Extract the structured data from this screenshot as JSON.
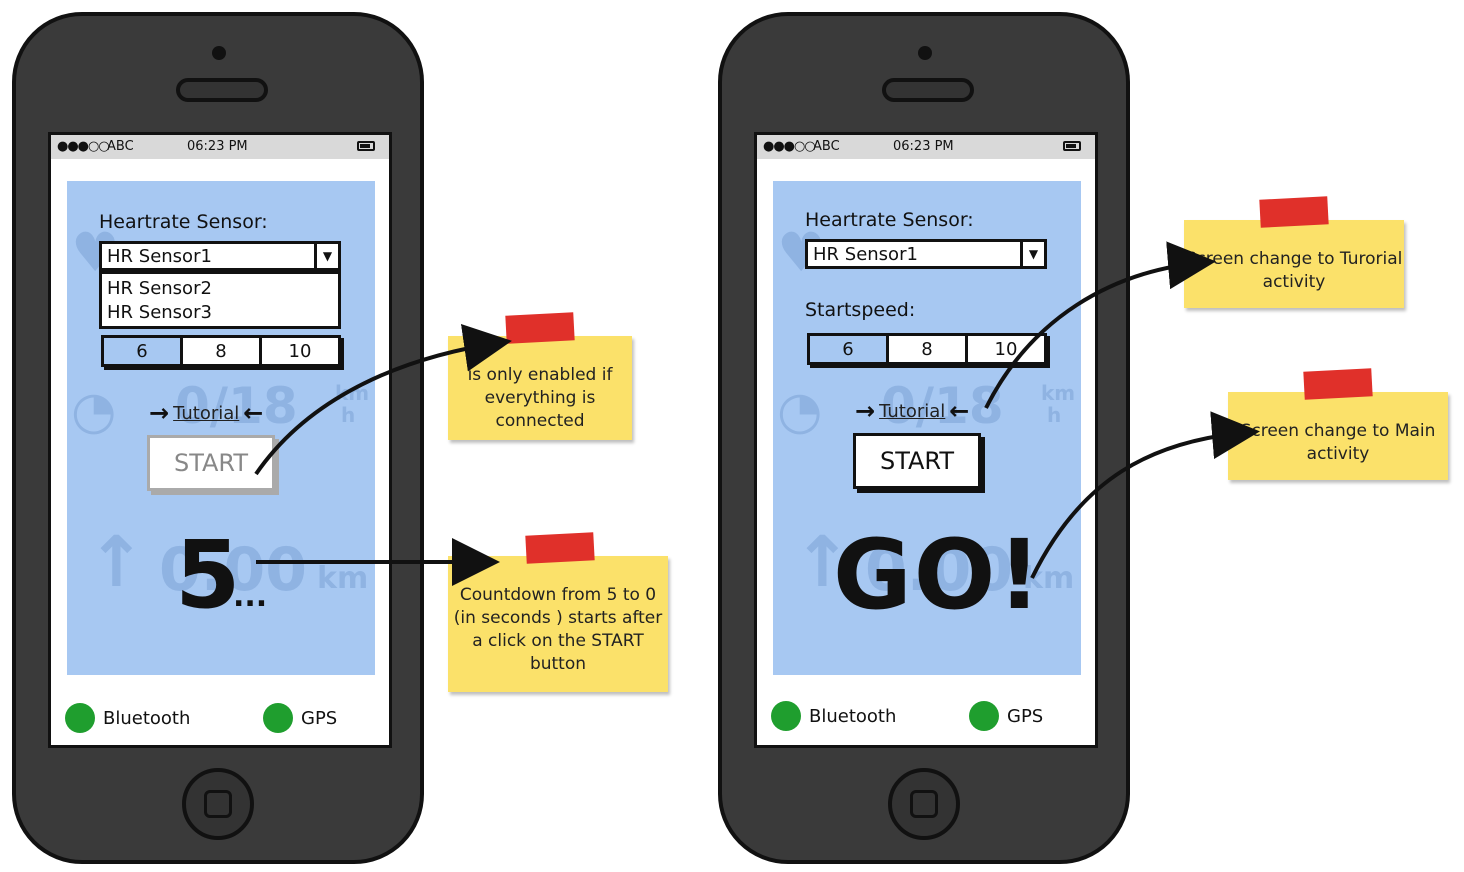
{
  "left_phone": {
    "status_bar": {
      "signal": "●●●○○",
      "carrier": "ABC",
      "time": "06:23 PM"
    },
    "sensor_label": "Heartrate Sensor:",
    "sensor_selected": "HR Sensor1",
    "sensor_options": [
      "HR Sensor2",
      "HR Sensor3"
    ],
    "speed_options": [
      "6",
      "8",
      "10"
    ],
    "tutorial_link": "Tutorial",
    "start_button": "START",
    "countdown_value": "5",
    "countdown_suffix": "...",
    "bluetooth_label": "Bluetooth",
    "gps_label": "GPS"
  },
  "right_phone": {
    "status_bar": {
      "signal": "●●●○○",
      "carrier": "ABC",
      "time": "06:23 PM"
    },
    "sensor_label": "Heartrate Sensor:",
    "sensor_selected": "HR Sensor1",
    "startspeed_label": "Startspeed:",
    "speed_options": [
      "6",
      "8",
      "10"
    ],
    "tutorial_link": "Tutorial",
    "start_button": "START",
    "go_text": "GO!",
    "bluetooth_label": "Bluetooth",
    "gps_label": "GPS"
  },
  "background_ghost": {
    "speed_value": "0/18",
    "speed_unit_top": "km",
    "speed_unit_bottom": "h",
    "distance_value": "0.00",
    "distance_unit": "km"
  },
  "notes": {
    "enabled_note": "is only enabled if everything is connected",
    "countdown_note": "Countdown from 5 to 0 (in seconds ) starts after a click on the START button",
    "tutorial_note": "Screen change to Turorial activity",
    "main_note": "Screen change to Main activity"
  },
  "colors": {
    "panel_blue": "#a7c8f2",
    "note_yellow": "#fbe16a",
    "tape_red": "#e0302a",
    "status_green": "#1f9e2e"
  }
}
